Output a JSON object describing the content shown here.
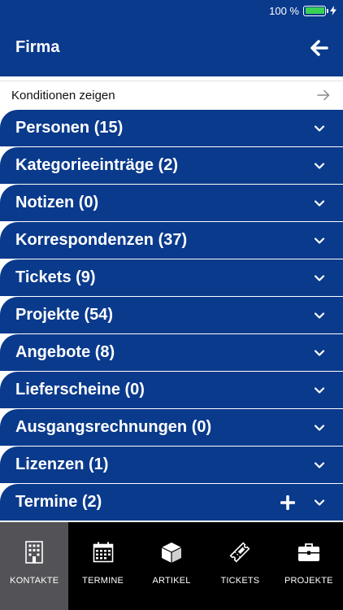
{
  "status_bar": {
    "battery_text": "100 %",
    "battery_level": 1.0,
    "battery_color": "#39d353"
  },
  "header": {
    "title": "Firma",
    "back_icon": "arrow-left-icon"
  },
  "conditions": {
    "label": "Konditionen zeigen",
    "icon": "arrow-right-icon"
  },
  "sections": [
    {
      "label": "Personen (15)"
    },
    {
      "label": "Kategorieeinträge (2)"
    },
    {
      "label": "Notizen (0)"
    },
    {
      "label": "Korrespondenzen (37)"
    },
    {
      "label": "Tickets (9)"
    },
    {
      "label": "Projekte (54)"
    },
    {
      "label": "Angebote (8)"
    },
    {
      "label": "Lieferscheine (0)"
    },
    {
      "label": "Ausgangsrechnungen (0)"
    },
    {
      "label": "Lizenzen (1)"
    },
    {
      "label": "Termine (2)",
      "has_add": true
    }
  ],
  "bottom_nav": [
    {
      "label": "KONTAKTE",
      "icon": "building-icon",
      "active": true
    },
    {
      "label": "TERMINE",
      "icon": "calendar-icon",
      "active": false
    },
    {
      "label": "ARTIKEL",
      "icon": "box-icon",
      "active": false
    },
    {
      "label": "TICKETS",
      "icon": "ticket-icon",
      "active": false
    },
    {
      "label": "PROJEKTE",
      "icon": "briefcase-icon",
      "active": false
    }
  ],
  "colors": {
    "primary": "#0a3a8c",
    "nav_background": "#000000",
    "nav_active": "#525257"
  }
}
